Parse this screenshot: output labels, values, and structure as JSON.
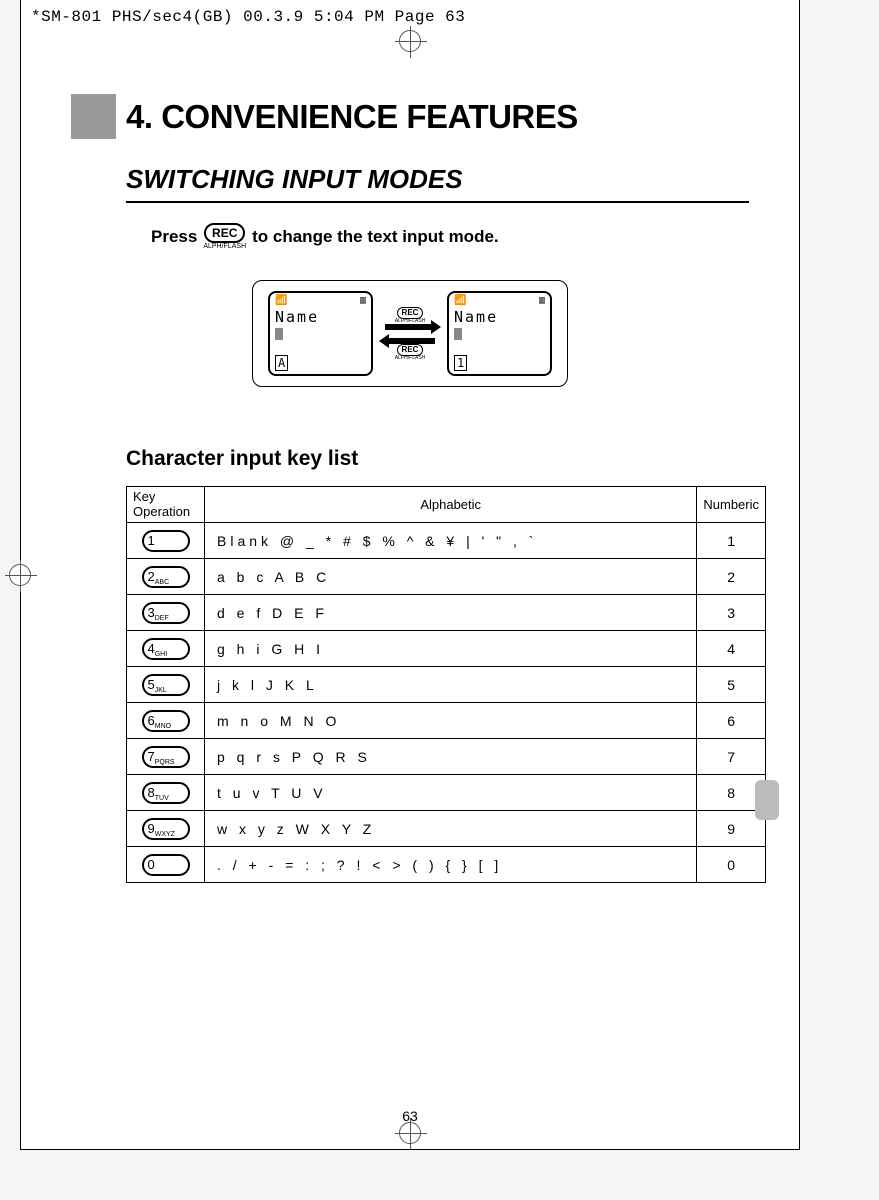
{
  "header": "*SM-801 PHS/sec4(GB)  00.3.9 5:04 PM  Page 63",
  "chapter": "4. CONVENIENCE FEATURES",
  "section_title": "SWITCHING INPUT MODES",
  "instruction_pre": "Press",
  "instruction_post": " to change the text input mode.",
  "rec_label": "REC",
  "rec_sublabel": "ALPH/FLASH",
  "screen": {
    "name_label": "Name",
    "mode_a": "A",
    "mode_1": "1"
  },
  "subsection": "Character input key list",
  "table": {
    "headers": {
      "key": "Key Operation",
      "alpha": "Alphabetic",
      "num": "Numberic"
    },
    "rows": [
      {
        "key_num": "1",
        "key_sub": "",
        "alpha": "Blank @ _ * # $ % ^ & ¥ | ' \" , `",
        "num": "1"
      },
      {
        "key_num": "2",
        "key_sub": "ABC",
        "alpha": "a b c A B C",
        "num": "2"
      },
      {
        "key_num": "3",
        "key_sub": "DEF",
        "alpha": "d e f D E F",
        "num": "3"
      },
      {
        "key_num": "4",
        "key_sub": "GHI",
        "alpha": "g h i G H I",
        "num": "4"
      },
      {
        "key_num": "5",
        "key_sub": "JKL",
        "alpha": "j k l J K L",
        "num": "5"
      },
      {
        "key_num": "6",
        "key_sub": "MNO",
        "alpha": "m n o M N O",
        "num": "6"
      },
      {
        "key_num": "7",
        "key_sub": "PQRS",
        "alpha": "p q r s P Q R S",
        "num": "7"
      },
      {
        "key_num": "8",
        "key_sub": "TUV",
        "alpha": "t u v T U V",
        "num": "8"
      },
      {
        "key_num": "9",
        "key_sub": "WXYZ",
        "alpha": "w x y z W X Y Z",
        "num": "9"
      },
      {
        "key_num": "0",
        "key_sub": "",
        "alpha": ". / + - = : ; ? ! < > ( ) { } [ ]",
        "num": "0"
      }
    ]
  },
  "page_number": "63"
}
